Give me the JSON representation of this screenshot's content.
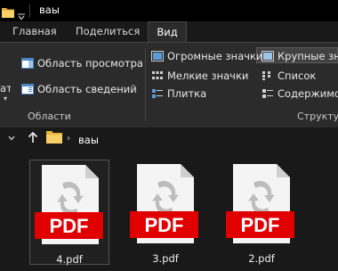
{
  "window": {
    "title": "вaы"
  },
  "tabs": [
    {
      "label": "Главная",
      "active": false
    },
    {
      "label": "Поделиться",
      "active": false
    },
    {
      "label": "Вид",
      "active": true
    }
  ],
  "ribbon": {
    "panes": {
      "left_label_fragment": "ать",
      "preview_pane": "Область просмотра",
      "details_pane": "Область сведений",
      "group_label": "Области"
    },
    "layout": {
      "extra_large_icons": "Огромные значки",
      "small_icons": "Мелкие значки",
      "tiles": "Плитка",
      "large_icons": "Крупные знач",
      "list": "Список",
      "content": "Содержимое",
      "group_label": "Структур",
      "selected": "large_icons"
    }
  },
  "address": {
    "path_segment": "вaы"
  },
  "files": [
    {
      "name": "4.pdf",
      "icon": "pdf-icon",
      "badge": "PDF",
      "selected": true
    },
    {
      "name": "3.pdf",
      "icon": "pdf-icon",
      "badge": "PDF",
      "selected": false
    },
    {
      "name": "2.pdf",
      "icon": "pdf-icon",
      "badge": "PDF",
      "selected": false
    }
  ],
  "colors": {
    "background": "#191919",
    "ribbon": "#2b2b2b",
    "pdf_red": "#e00000",
    "folder_yellow": "#f3c84b"
  }
}
